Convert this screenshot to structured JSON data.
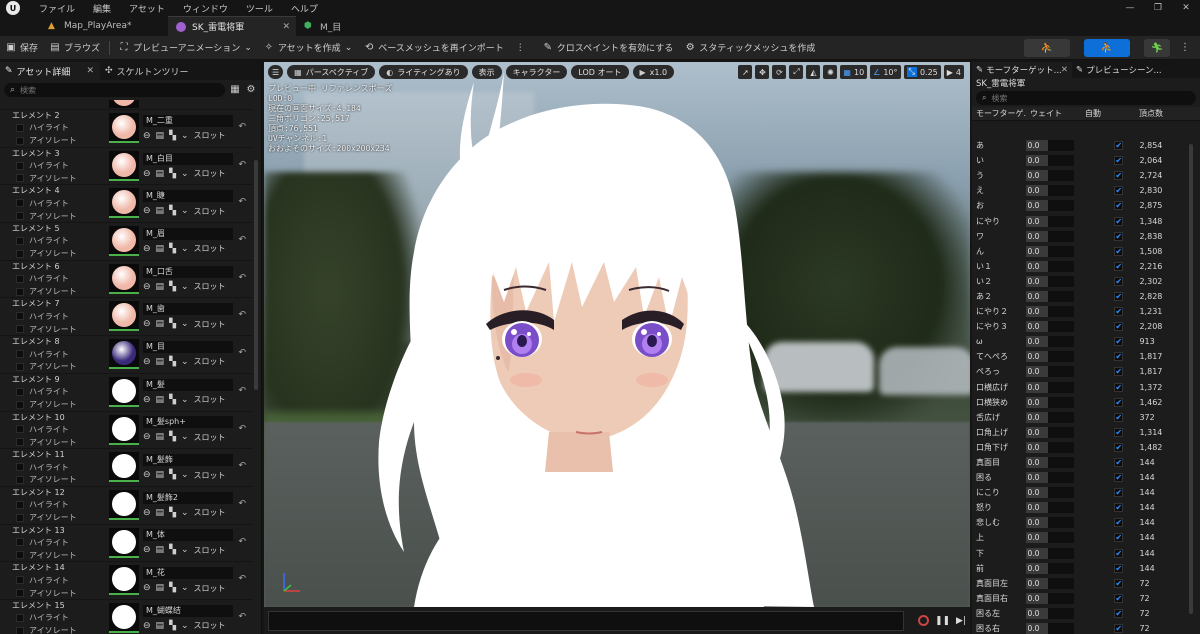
{
  "menu": [
    "ファイル",
    "編集",
    "アセット",
    "ウィンドウ",
    "ツール",
    "ヘルプ"
  ],
  "tabs": [
    {
      "label": "Map_PlayArea*",
      "active": false
    },
    {
      "label": "SK_雷電将軍",
      "active": true
    },
    {
      "label": "M_目",
      "active": false
    }
  ],
  "toolbar": {
    "save": "保存",
    "browse": "ブラウズ",
    "preview_anim": "プレビューアニメーション",
    "create_asset": "アセットを作成",
    "reimport": "ベースメッシュを再インポート",
    "cloth_paint": "クロスペイントを有効にする",
    "static_mesh": "スタティックメッシュを作成"
  },
  "left_panel": {
    "tab_details": "アセット詳細",
    "tab_skeleton": "スケルトンツリー",
    "search_placeholder": "検索",
    "highlight": "ハイライト",
    "isolate": "アイソレート",
    "slot": "スロット",
    "elements": [
      {
        "name": "エレメント 2",
        "material": "M_二重",
        "color": "#f0b8a8"
      },
      {
        "name": "エレメント 3",
        "material": "M_白目",
        "color": "#f0b8a8"
      },
      {
        "name": "エレメント 4",
        "material": "M_睫",
        "color": "#f0b8a8"
      },
      {
        "name": "エレメント 5",
        "material": "M_眉",
        "color": "#f0b8a8"
      },
      {
        "name": "エレメント 6",
        "material": "M_口舌",
        "color": "#f0b8a8"
      },
      {
        "name": "エレメント 7",
        "material": "M_歯",
        "color": "#f0b8a8"
      },
      {
        "name": "エレメント 8",
        "material": "M_目",
        "color": "#3b2a7a"
      },
      {
        "name": "エレメント 9",
        "material": "M_髪",
        "color": "#ffffff"
      },
      {
        "name": "エレメント 10",
        "material": "M_髪sph+",
        "color": "#ffffff"
      },
      {
        "name": "エレメント 11",
        "material": "M_髪飾",
        "color": "#ffffff"
      },
      {
        "name": "エレメント 12",
        "material": "M_髪飾2",
        "color": "#ffffff"
      },
      {
        "name": "エレメント 13",
        "material": "M_体",
        "color": "#ffffff"
      },
      {
        "name": "エレメント 14",
        "material": "M_花",
        "color": "#ffffff"
      },
      {
        "name": "エレメント 15",
        "material": "M_蝴蝶结",
        "color": "#ffffff"
      }
    ]
  },
  "viewport": {
    "perspective": "パースペクティブ",
    "lighting": "ライティングあり",
    "show": "表示",
    "character": "キャラクター",
    "lod": "LOD オート",
    "speed": "x1.0",
    "grid_value": "10",
    "angle_value": "10°",
    "scale_value": "0.25",
    "camera_value": "4",
    "info": [
      "プレビュー中 リファレンスポーズ",
      "LOD:0",
      "現在の画面サイズ:4.184",
      "三角ポリゴン:25,517",
      "頂点:76,551",
      "UVチャンネル:1",
      "おおよそのサイズ:200x200x234"
    ]
  },
  "right_panel": {
    "tab_morph": "モーフターゲット...",
    "tab_preview": "プレビューシーン...",
    "mesh_name": "SK_雷電将軍",
    "search_placeholder": "検索",
    "headers": {
      "name": "モーフターゲ...",
      "weight": "ウェイト",
      "auto": "自動",
      "verts": "頂点数"
    },
    "rows": [
      {
        "name": "あ",
        "weight": "0.0",
        "verts": "2,854"
      },
      {
        "name": "い",
        "weight": "0.0",
        "verts": "2,064"
      },
      {
        "name": "う",
        "weight": "0.0",
        "verts": "2,724"
      },
      {
        "name": "え",
        "weight": "0.0",
        "verts": "2,830"
      },
      {
        "name": "お",
        "weight": "0.0",
        "verts": "2,875"
      },
      {
        "name": "にやり",
        "weight": "0.0",
        "verts": "1,348"
      },
      {
        "name": "ワ",
        "weight": "0.0",
        "verts": "2,838"
      },
      {
        "name": "ん",
        "weight": "0.0",
        "verts": "1,508"
      },
      {
        "name": "い１",
        "weight": "0.0",
        "verts": "2,216"
      },
      {
        "name": "い２",
        "weight": "0.0",
        "verts": "2,302"
      },
      {
        "name": "あ２",
        "weight": "0.0",
        "verts": "2,828"
      },
      {
        "name": "にやり２",
        "weight": "0.0",
        "verts": "1,231"
      },
      {
        "name": "にやり３",
        "weight": "0.0",
        "verts": "2,208"
      },
      {
        "name": "ω",
        "weight": "0.0",
        "verts": "913"
      },
      {
        "name": "てへぺろ",
        "weight": "0.0",
        "verts": "1,817"
      },
      {
        "name": "ぺろっ",
        "weight": "0.0",
        "verts": "1,817"
      },
      {
        "name": "口横広げ",
        "weight": "0.0",
        "verts": "1,372"
      },
      {
        "name": "口横狭め",
        "weight": "0.0",
        "verts": "1,462"
      },
      {
        "name": "舌広げ",
        "weight": "0.0",
        "verts": "372"
      },
      {
        "name": "口角上げ",
        "weight": "0.0",
        "verts": "1,314"
      },
      {
        "name": "口角下げ",
        "weight": "0.0",
        "verts": "1,482"
      },
      {
        "name": "真面目",
        "weight": "0.0",
        "verts": "144"
      },
      {
        "name": "困る",
        "weight": "0.0",
        "verts": "144"
      },
      {
        "name": "にこり",
        "weight": "0.0",
        "verts": "144"
      },
      {
        "name": "怒り",
        "weight": "0.0",
        "verts": "144"
      },
      {
        "name": "悲しむ",
        "weight": "0.0",
        "verts": "144"
      },
      {
        "name": "上",
        "weight": "0.0",
        "verts": "144"
      },
      {
        "name": "下",
        "weight": "0.0",
        "verts": "144"
      },
      {
        "name": "前",
        "weight": "0.0",
        "verts": "144"
      },
      {
        "name": "真面目左",
        "weight": "0.0",
        "verts": "72"
      },
      {
        "name": "真面目右",
        "weight": "0.0",
        "verts": "72"
      },
      {
        "name": "困る左",
        "weight": "0.0",
        "verts": "72"
      },
      {
        "name": "困る右",
        "weight": "0.0",
        "verts": "72"
      }
    ]
  },
  "colors": {
    "accent": "#0f6fd8",
    "panel": "#1c1c1c",
    "toolbar": "#242424"
  }
}
